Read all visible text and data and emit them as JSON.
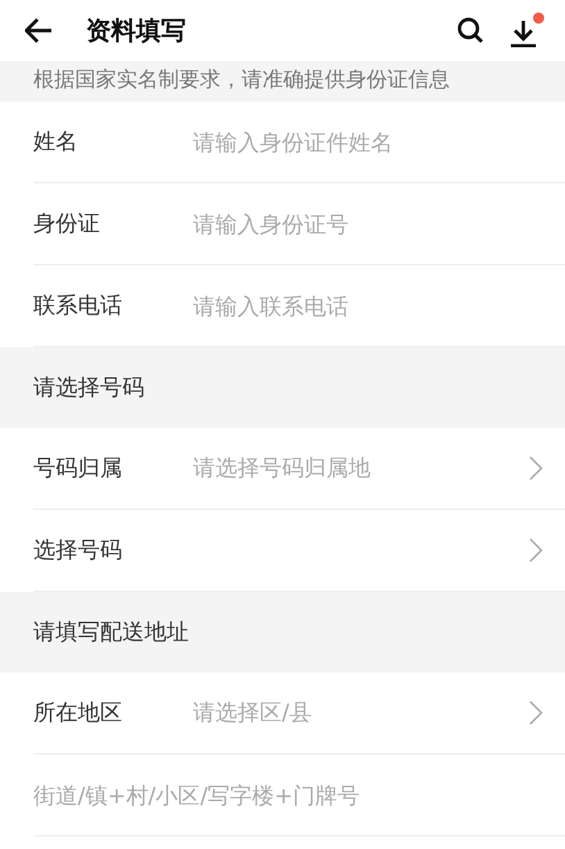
{
  "header": {
    "title": "资料填写",
    "download_badge": true
  },
  "notice": "根据国家实名制要求，请准确提供身份证信息",
  "sections": [
    {
      "rows": [
        {
          "kind": "input",
          "label": "姓名",
          "placeholder": "请输入身份证件姓名"
        },
        {
          "kind": "input",
          "label": "身份证",
          "placeholder": "请输入身份证号"
        },
        {
          "kind": "input",
          "label": "联系电话",
          "placeholder": "请输入联系电话"
        }
      ]
    },
    {
      "title": "请选择号码",
      "rows": [
        {
          "kind": "select",
          "label": "号码归属",
          "placeholder": "请选择号码归属地"
        },
        {
          "kind": "select",
          "label": "选择号码"
        }
      ]
    },
    {
      "title": "请填写配送地址",
      "rows": [
        {
          "kind": "select",
          "label": "所在地区",
          "placeholder": "请选择区/县"
        },
        {
          "kind": "textarea",
          "placeholder": "街道/镇+村/小区/写字楼+门牌号"
        }
      ]
    }
  ]
}
